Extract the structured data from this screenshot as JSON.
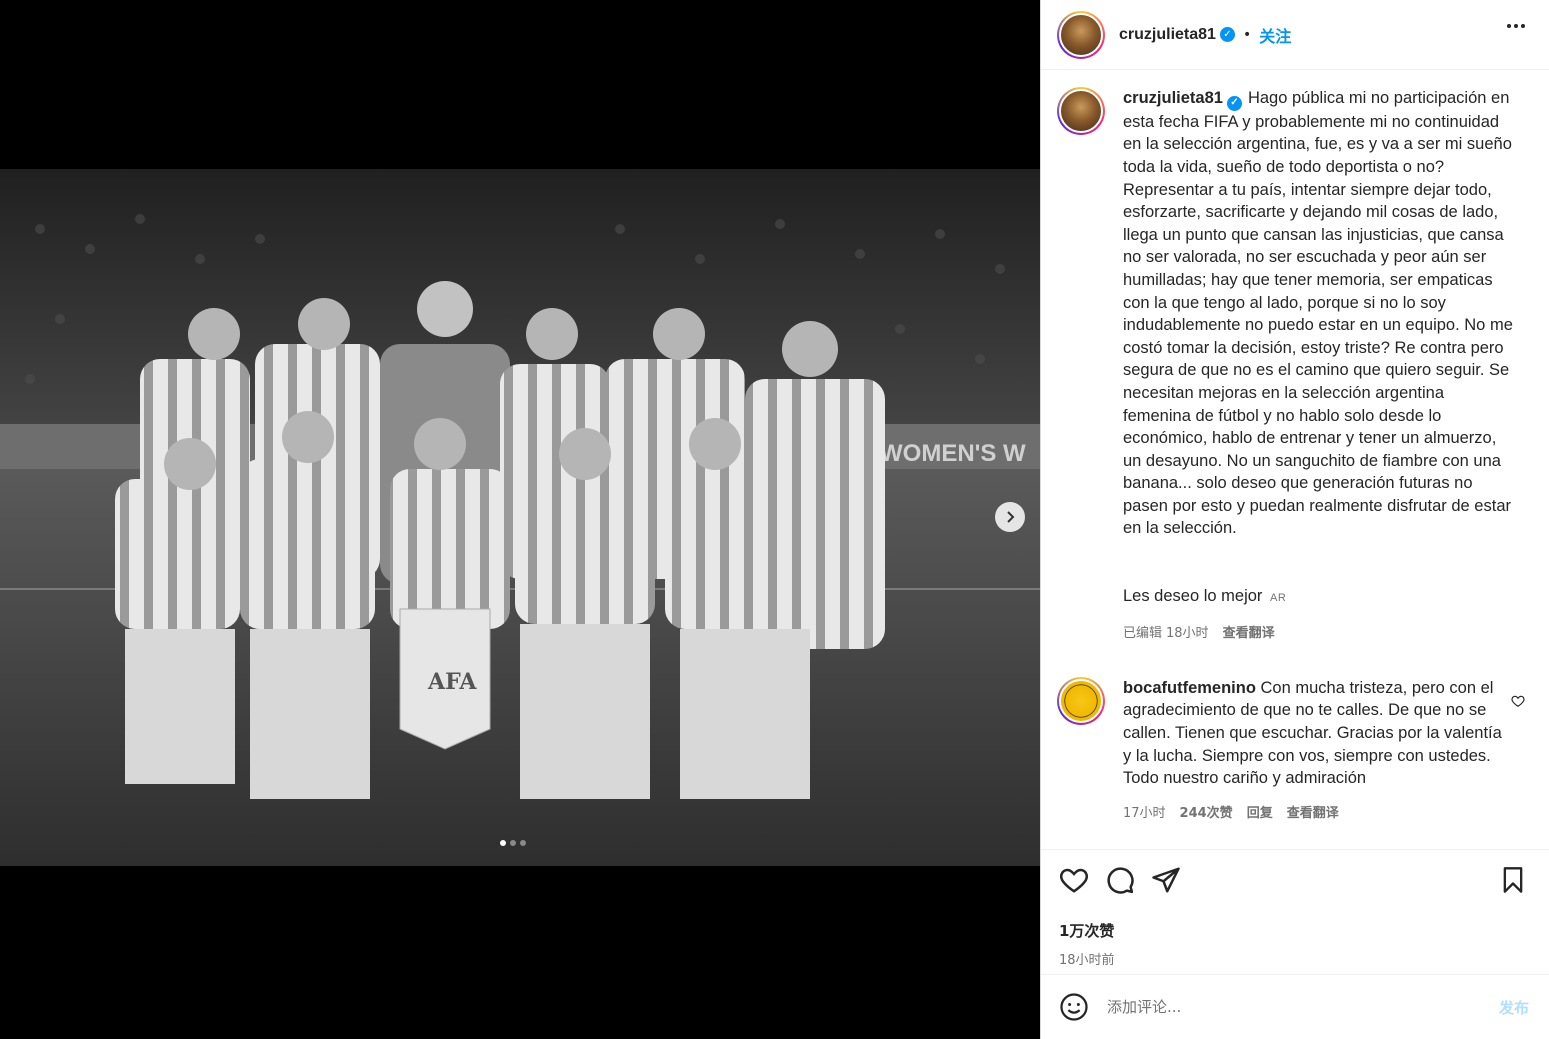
{
  "post": {
    "media": {
      "description_icon": "team-photo",
      "carousel_count": 3,
      "carousel_active": 1,
      "next_icon": "chevron-right-icon"
    },
    "header": {
      "username": "cruzjulieta81",
      "verified_icon": "verified-badge-icon",
      "separator": "•",
      "follow_label": "关注",
      "more_icon": "more-horizontal-icon"
    },
    "caption": {
      "username": "cruzjulieta81",
      "text": "Hago pública mi no participación en esta fecha FIFA y probablemente mi no continuidad en la selección argentina, fue, es y va a ser mi sueño toda la vida, sueño de todo deportista o no? Representar a tu país, intentar siempre dejar todo, esforzarte, sacrificarte y dejando mil cosas de lado, llega un punto que cansan las injusticias, que cansa no ser valorada, no ser escuchada y peor aún ser humilladas; hay que tener memoria, ser empaticas con la que tengo al lado, porque si no lo soy indudablemente no puedo estar en un equipo. No me costó tomar la decisión, estoy triste? Re contra pero segura de que no es el camino que quiero seguir. Se necesitan mejoras en la selección argentina femenina de fútbol y no hablo solo desde lo económico, hablo de entrenar y tener un almuerzo, un desayuno. No un sanguchito de fiambre con una banana... solo deseo que generación futuras no pasen por esto y puedan realmente disfrutar de estar en la selección.",
      "closing": "Les deseo lo mejor",
      "closing_tag": "AR",
      "edited_label": "已编辑",
      "time": "18小时",
      "translate_label": "查看翻译"
    },
    "comments": [
      {
        "username": "bocafutfemenino",
        "text": "Con mucha tristeza, pero con el agradecimiento de que no te calles. De que no se callen. Tienen que escuchar. Gracias por la valentía y la lucha. Siempre con vos, siempre con ustedes. Todo nuestro cariño y admiración",
        "time": "17小时",
        "likes": "244次赞",
        "reply_label": "回复",
        "translate_label": "查看翻译"
      }
    ],
    "actions": {
      "like_icon": "heart-icon",
      "comment_icon": "comment-icon",
      "share_icon": "send-icon",
      "save_icon": "bookmark-icon"
    },
    "likes_count": "1万次赞",
    "posted_time": "18小时前",
    "add_comment": {
      "placeholder": "添加评论...",
      "post_label": "发布",
      "emoji_icon": "emoji-icon"
    }
  }
}
